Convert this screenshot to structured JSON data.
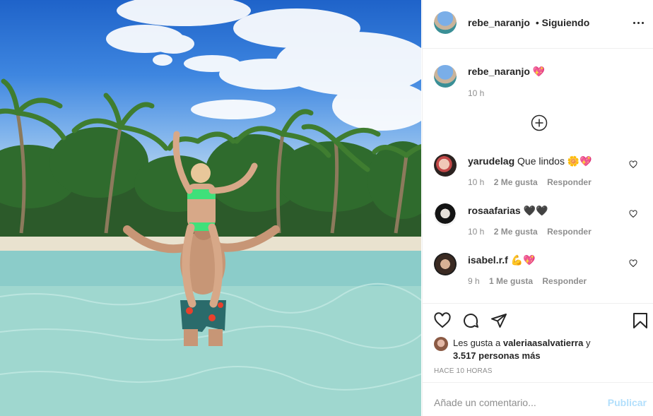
{
  "post": {
    "username": "rebe_naranjo",
    "follow_status": "Siguiendo",
    "separator": "•"
  },
  "caption": {
    "username": "rebe_naranjo",
    "text": "💖",
    "time": "10 h",
    "load_more_icon": "plus-circle-icon"
  },
  "comments": [
    {
      "username": "yarudelag",
      "text": "Que lindos 🌼💖",
      "time": "10 h",
      "likes": "2 Me gusta",
      "reply": "Responder"
    },
    {
      "username": "rosaafarias",
      "text": "🖤🖤",
      "time": "10 h",
      "likes": "2 Me gusta",
      "reply": "Responder"
    },
    {
      "username": "isabel.r.f",
      "text": "💪💖",
      "time": "9 h",
      "likes": "1 Me gusta",
      "reply": "Responder"
    }
  ],
  "likes": {
    "prefix": "Les gusta a",
    "user": "valeriaasalvatierra",
    "conj": "y",
    "others": "3.517 personas más"
  },
  "timestamp": "HACE 10 HORAS",
  "comment_box": {
    "placeholder": "Añade un comentario...",
    "publish": "Publicar"
  },
  "colors": {
    "text": "#262626",
    "secondary": "#8e8e8e",
    "publish_disabled": "#b2dffc",
    "border": "#efefef"
  }
}
